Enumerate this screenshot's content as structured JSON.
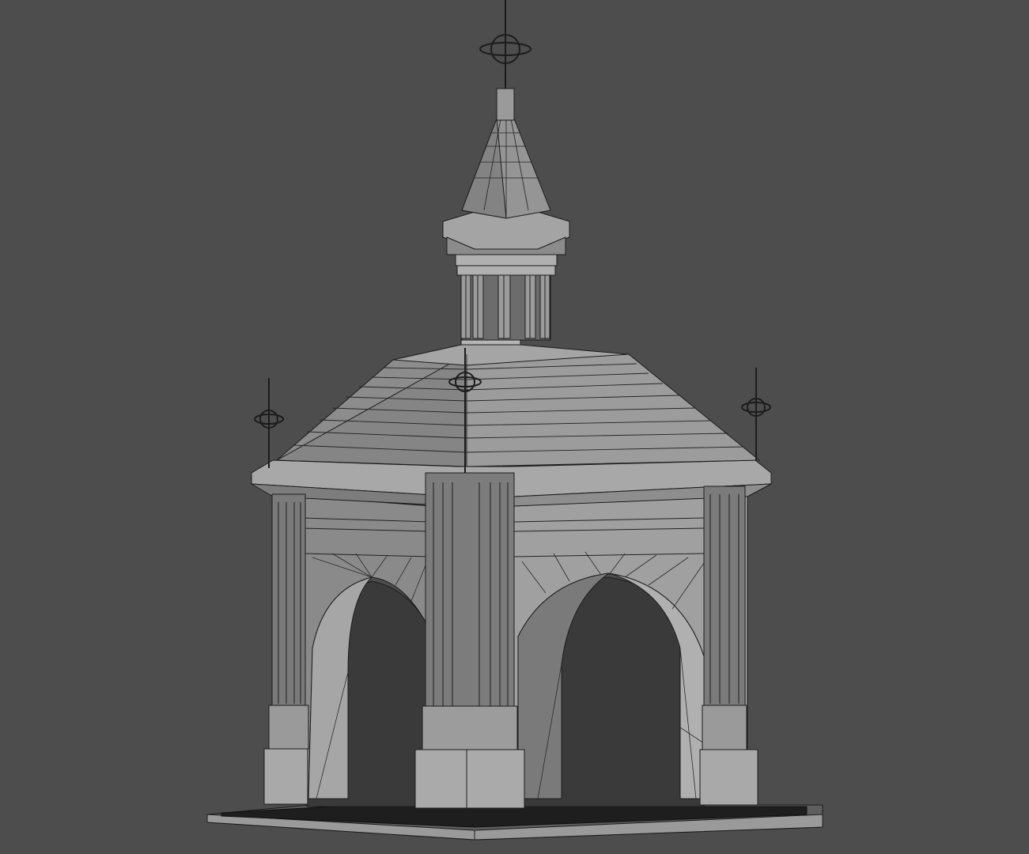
{
  "scene": {
    "background_color": "#4d4d4d",
    "model_fill": "#8f8f8f",
    "model_light": "#a3a3a3",
    "model_dark": "#6e6e6e",
    "wire_color": "#1c1c1c"
  }
}
